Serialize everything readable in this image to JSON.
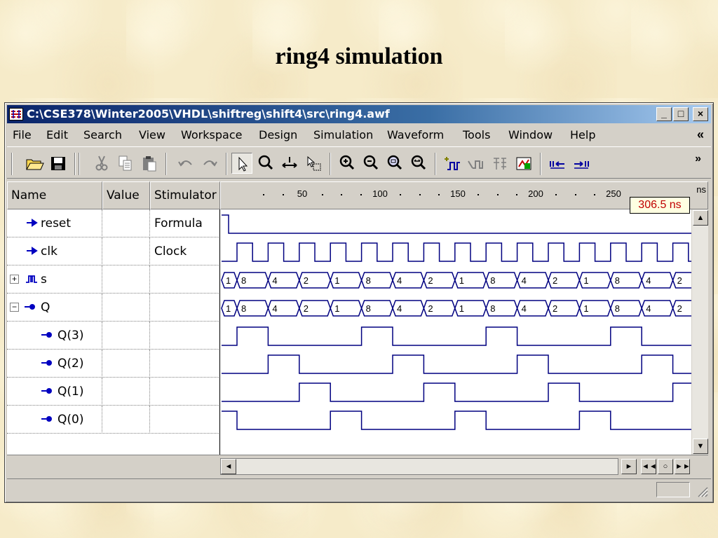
{
  "slide": {
    "title": "ring4 simulation"
  },
  "window": {
    "title": "C:\\CSE378\\Winter2005\\VHDL\\shiftreg\\shift4\\src\\ring4.awf",
    "controls": {
      "minimize": "_",
      "maximize": "□",
      "close": "×"
    }
  },
  "menu": {
    "items": [
      "File",
      "Edit",
      "Search",
      "View",
      "Workspace",
      "Design",
      "Simulation",
      "Waveform",
      "Tools",
      "Window",
      "Help"
    ],
    "overflow": "«"
  },
  "toolbar": {
    "icons": [
      "open-folder-icon",
      "save-icon",
      "cut-icon",
      "copy-icon",
      "paste-icon",
      "undo-icon",
      "redo-icon",
      "pointer-icon",
      "zoom-icon",
      "measure-icon",
      "select-icon",
      "zoom-in-icon",
      "zoom-out-icon",
      "zoom-fit-icon",
      "zoom-full-icon",
      "add-signal-icon",
      "remove-signal-icon",
      "bus-icon",
      "stimulator-icon",
      "prev-edge-icon",
      "next-edge-icon"
    ],
    "overflow": "»"
  },
  "grid": {
    "headers": {
      "name": "Name",
      "value": "Value",
      "stimulator": "Stimulator"
    },
    "ruler": {
      "labels": [
        "50",
        "100",
        "150",
        "200",
        "250"
      ],
      "unit": "ns",
      "cursor": "306.5 ns"
    },
    "rows": [
      {
        "name": "reset",
        "value": "",
        "stimulator": "Formula",
        "kind": "input",
        "indent": 0
      },
      {
        "name": "clk",
        "value": "",
        "stimulator": "Clock",
        "kind": "input",
        "indent": 0
      },
      {
        "name": "s",
        "value": "",
        "stimulator": "",
        "kind": "bus",
        "expander": "+",
        "indent": 0
      },
      {
        "name": "Q",
        "value": "",
        "stimulator": "",
        "kind": "output",
        "expander": "−",
        "indent": 0
      },
      {
        "name": "Q(3)",
        "value": "",
        "stimulator": "",
        "kind": "output",
        "indent": 1
      },
      {
        "name": "Q(2)",
        "value": "",
        "stimulator": "",
        "kind": "output",
        "indent": 1
      },
      {
        "name": "Q(1)",
        "value": "",
        "stimulator": "",
        "kind": "output",
        "indent": 1
      },
      {
        "name": "Q(0)",
        "value": "",
        "stimulator": "",
        "kind": "output",
        "indent": 1
      }
    ]
  },
  "waveforms": {
    "bus_values": [
      "1",
      "8",
      "4",
      "2",
      "1",
      "8",
      "4",
      "2",
      "1",
      "8",
      "4",
      "2",
      "1",
      "8",
      "4",
      "2"
    ]
  },
  "scroll": {
    "up": "▲",
    "down": "▼",
    "left": "◄",
    "right": "►",
    "rewind": "◄◄",
    "stop": "○",
    "forward": "►►"
  }
}
